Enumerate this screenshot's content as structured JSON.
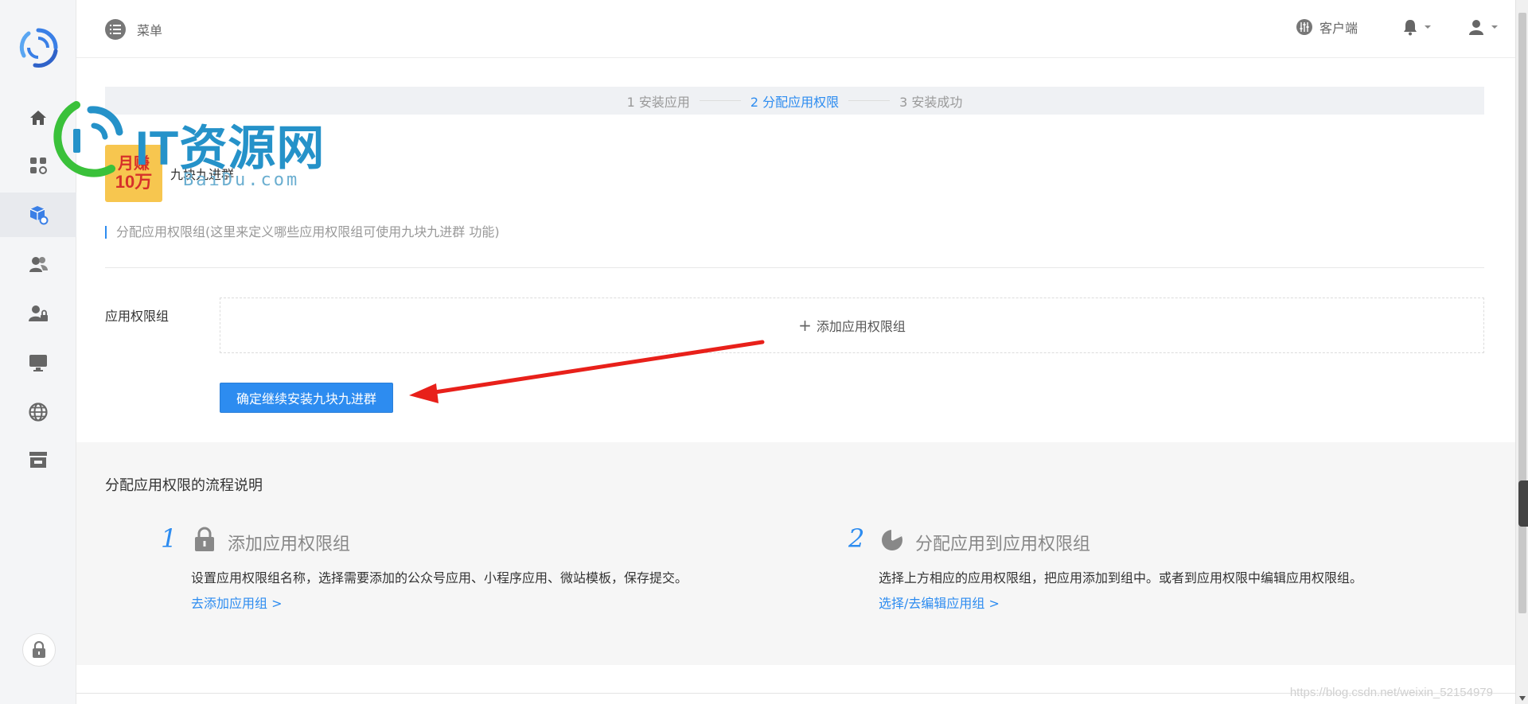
{
  "topbar": {
    "menu_label": "菜单",
    "client_label": "客户端"
  },
  "sidebar": {
    "items": [
      {
        "icon": "home-icon"
      },
      {
        "icon": "apps-icon"
      },
      {
        "icon": "app-settings-icon",
        "active": true
      },
      {
        "icon": "users-icon"
      },
      {
        "icon": "user-lock-icon"
      },
      {
        "icon": "monitor-icon"
      },
      {
        "icon": "globe-icon"
      },
      {
        "icon": "store-icon"
      }
    ],
    "lock_icon": "lock-icon"
  },
  "steps": [
    {
      "label": "1 安装应用",
      "active": false
    },
    {
      "label": "2 分配应用权限",
      "active": true
    },
    {
      "label": "3 安装成功",
      "active": false
    }
  ],
  "app": {
    "thumb_line1": "月赚",
    "thumb_line2": "10万",
    "name": "九块九进群"
  },
  "section_title": "分配应用权限组(这里来定义哪些应用权限组可使用九块九进群 功能)",
  "form": {
    "label": "应用权限组",
    "add_plus": "+",
    "add_text": "添加应用权限组",
    "confirm_button": "确定继续安装九块九进群"
  },
  "help": {
    "title": "分配应用权限的流程说明",
    "steps": [
      {
        "num": "1",
        "icon": "lock-icon",
        "head": "添加应用权限组",
        "desc": "设置应用权限组名称，选择需要添加的公众号应用、小程序应用、微站模板，保存提交。",
        "link": "去添加应用组 >"
      },
      {
        "num": "2",
        "icon": "pie-chart-icon",
        "head": "分配应用到应用权限组",
        "desc": "选择上方相应的应用权限组，把应用添加到组中。或者到应用权限中编辑应用权限组。",
        "link": "选择/去编辑应用组 >"
      }
    ]
  },
  "watermark": {
    "text": "IT资源网",
    "sub": "BaiDu.com"
  },
  "csdn_watermark": "https://blog.csdn.net/weixin_52154979",
  "colors": {
    "accent": "#2d8cf0",
    "annotation_arrow": "#e8201a",
    "sidebar_bg": "#f4f5f7",
    "help_bg": "#f6f6f6"
  }
}
